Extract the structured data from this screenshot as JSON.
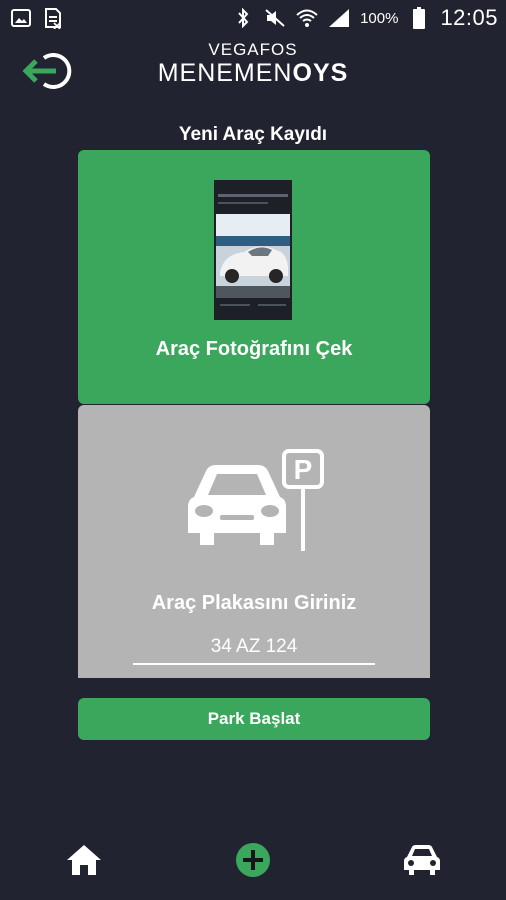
{
  "status_bar": {
    "battery_percent": "100%",
    "time": "12:05",
    "left_icons": [
      "gallery-icon",
      "sim-icon"
    ],
    "right_icons": [
      "bluetooth-icon",
      "mute-icon",
      "wifi-icon",
      "signal-icon",
      "battery-icon"
    ]
  },
  "header": {
    "brand_top": "VEGAFOS",
    "brand_bottom_light": "MENEMEN",
    "brand_bottom_bold": "OYS",
    "back_icon": "logout-icon"
  },
  "page": {
    "title": "Yeni Araç Kayıdı"
  },
  "photo_card": {
    "label": "Araç Fotoğrafını Çek",
    "image": "car-photo-thumbnail"
  },
  "plate_card": {
    "label": "Araç Plakasını Giriniz",
    "input_value": "34 AZ 124",
    "illustration": "car-parking-icon",
    "parking_sign_letter": "P"
  },
  "actions": {
    "park_button_label": "Park Başlat"
  },
  "bottom_nav": {
    "items": [
      "home-icon",
      "add-icon",
      "car-icon"
    ]
  },
  "colors": {
    "background": "#222330",
    "accent_green": "#3aa75d",
    "card_gray": "#b4b4b4",
    "caret": "#d6336c"
  }
}
